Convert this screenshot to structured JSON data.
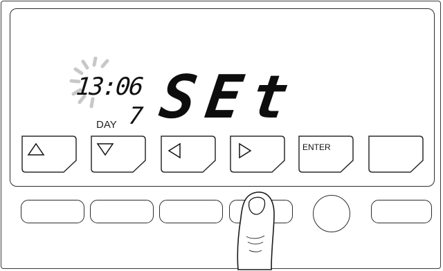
{
  "display": {
    "clock_time": "13:06",
    "day_number": "7",
    "day_label": "DAY",
    "main_text": "SEt"
  },
  "soft_keys": [
    {
      "name": "up-arrow-key",
      "icon": "up-triangle-icon",
      "label": ""
    },
    {
      "name": "down-arrow-key",
      "icon": "down-triangle-icon",
      "label": ""
    },
    {
      "name": "left-arrow-key",
      "icon": "left-triangle-icon",
      "label": ""
    },
    {
      "name": "right-arrow-key",
      "icon": "right-triangle-icon",
      "label": ""
    },
    {
      "name": "enter-key",
      "icon": "",
      "label": "ENTER"
    },
    {
      "name": "blank-key",
      "icon": "",
      "label": ""
    }
  ],
  "hardware_buttons": {
    "pressed_button": "button-4",
    "round_button_icon": "round-button"
  },
  "colors": {
    "outline": "#2b2b2b",
    "background": "#ffffff",
    "text": "#111111",
    "blink_rays": "#c8c8c8"
  }
}
